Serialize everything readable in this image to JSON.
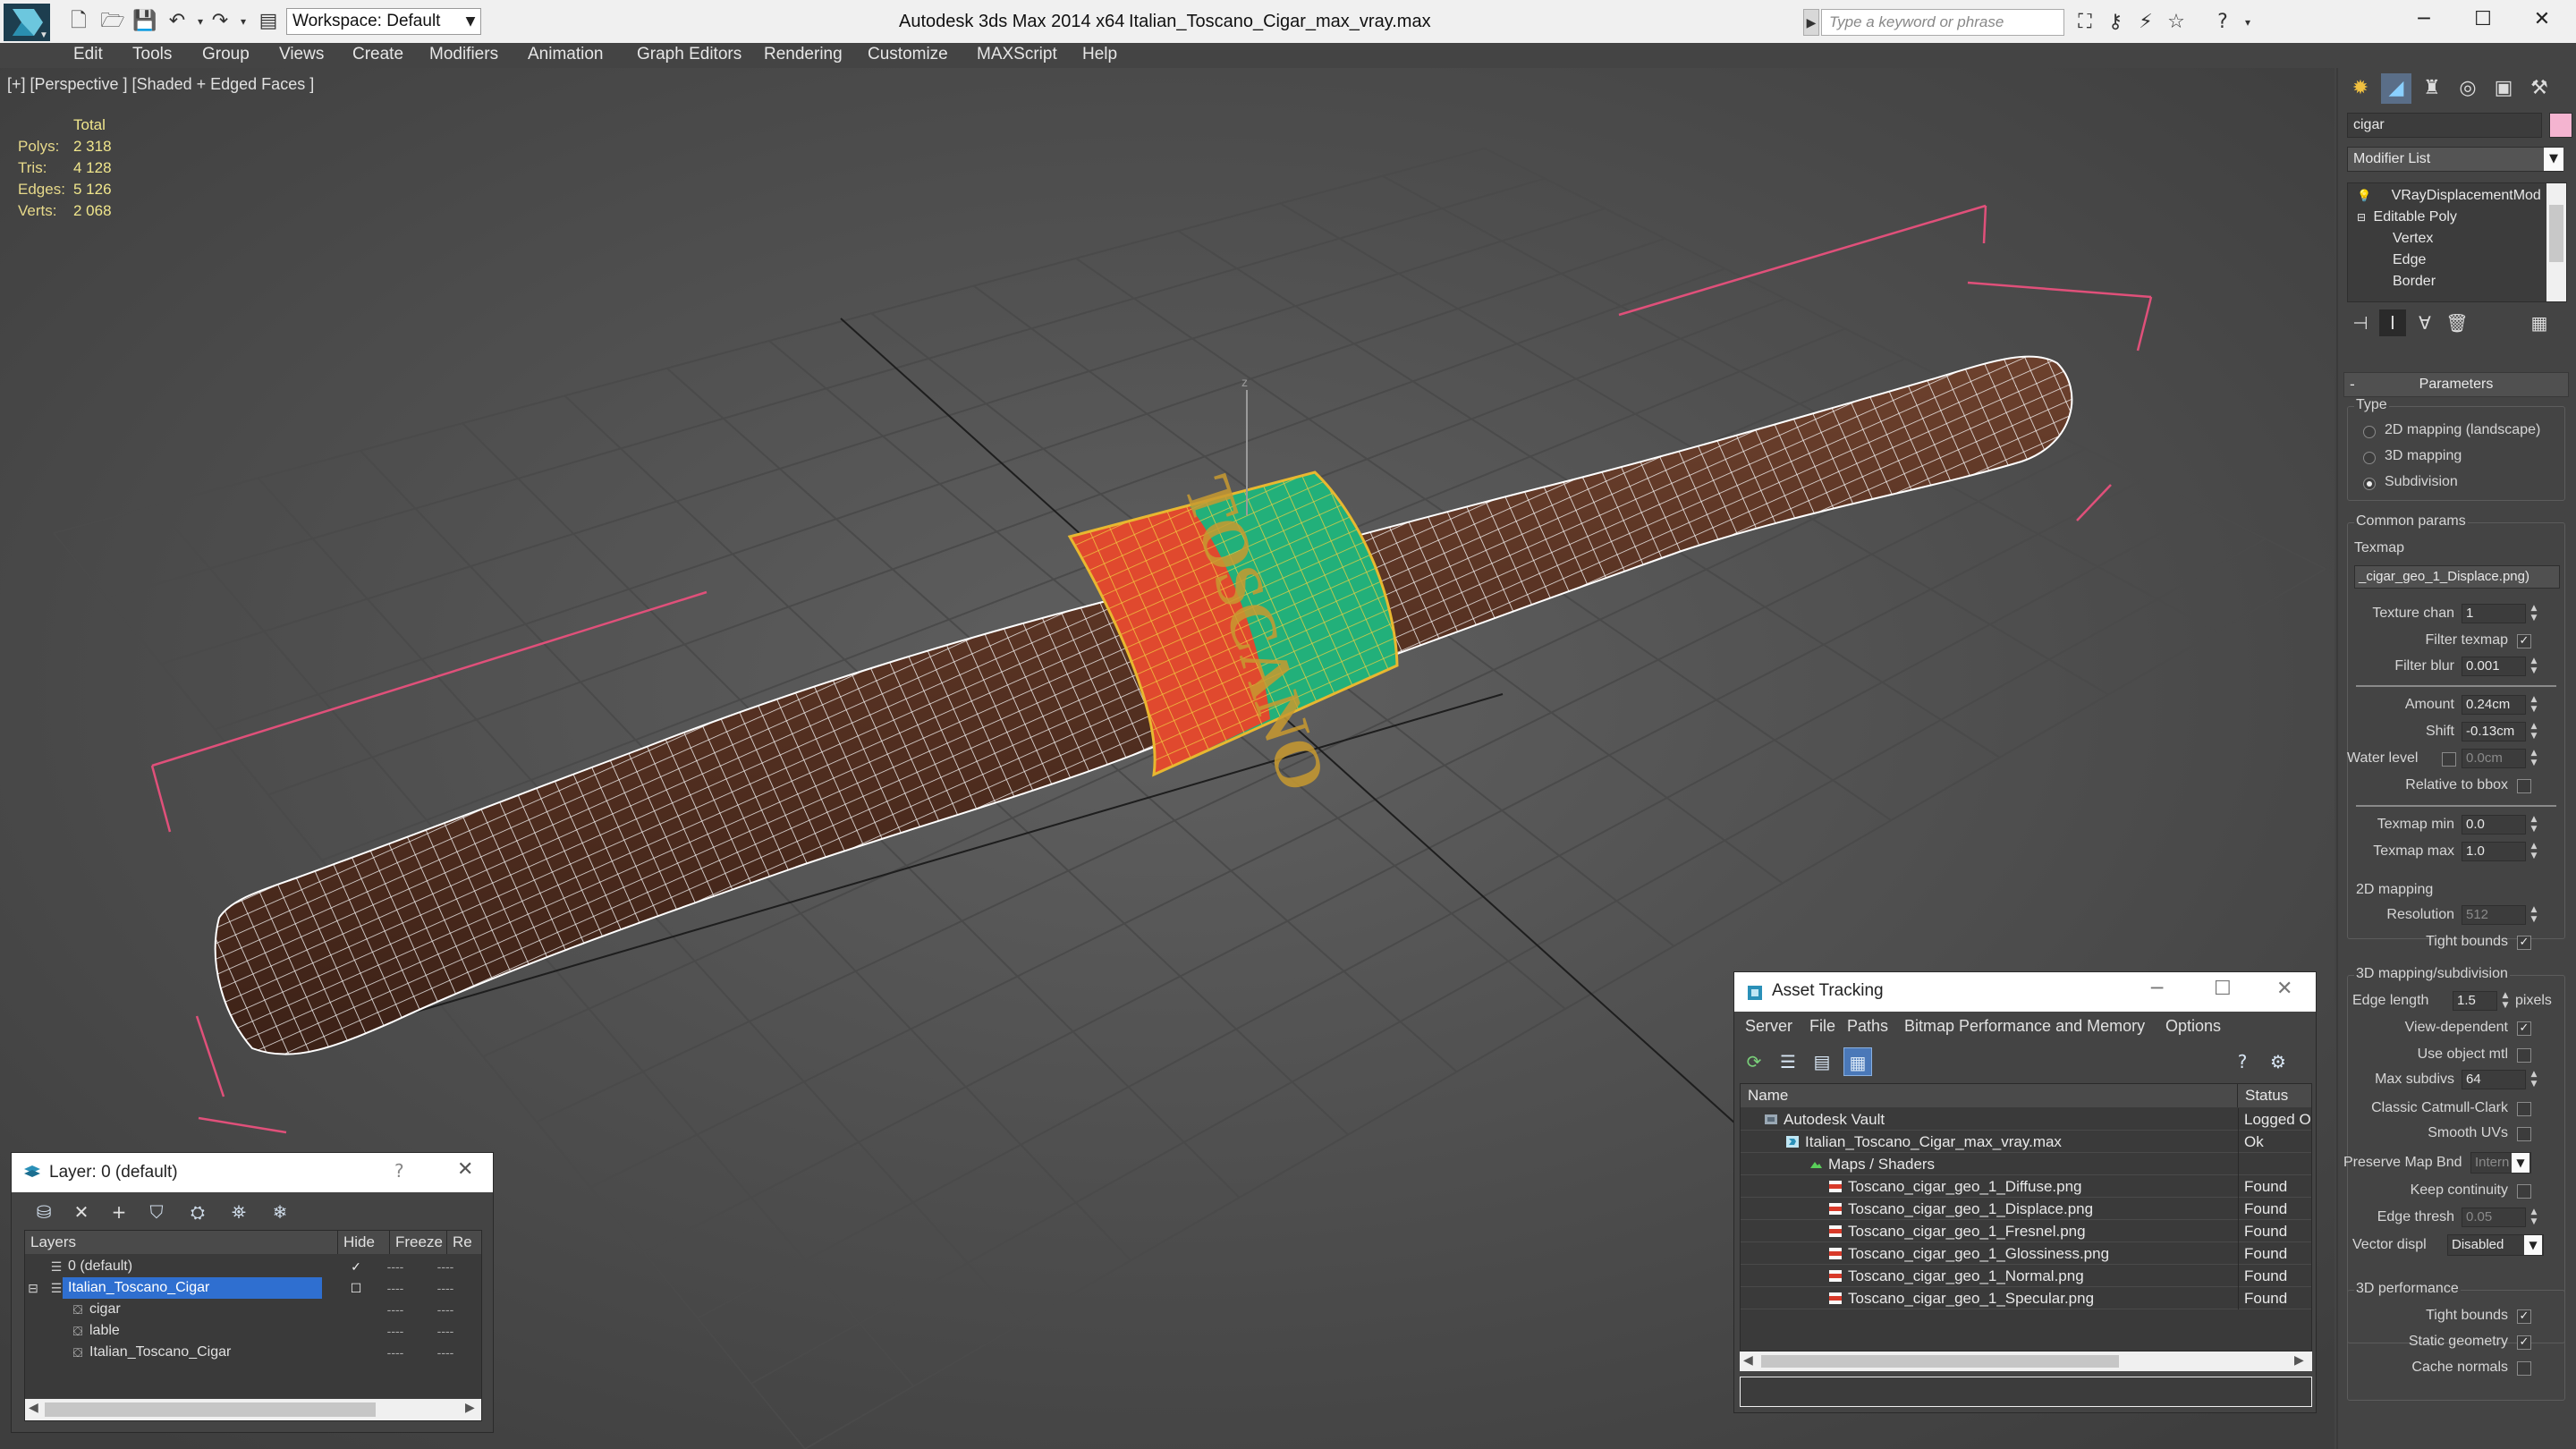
{
  "titlebar": {
    "app_title": "Autodesk 3ds Max 2014 x64",
    "document": "Italian_Toscano_Cigar_max_vray.max",
    "workspace": "Workspace: Default",
    "search_placeholder": "Type a keyword or phrase"
  },
  "menu": [
    "Edit",
    "Tools",
    "Group",
    "Views",
    "Create",
    "Modifiers",
    "Animation",
    "Graph Editors",
    "Rendering",
    "Customize",
    "MAXScript",
    "Help"
  ],
  "viewport": {
    "label": "[+] [Perspective ] [Shaded + Edged Faces ]",
    "stats": {
      "header": "Total",
      "rows": [
        {
          "label": "Polys:",
          "value": "2 318"
        },
        {
          "label": "Tris:",
          "value": "4 128"
        },
        {
          "label": "Edges:",
          "value": "5 126"
        },
        {
          "label": "Verts:",
          "value": "2 068"
        }
      ]
    },
    "band_text": "TOSCANO"
  },
  "command_panel": {
    "object_name": "cigar",
    "object_color": "#f4b4d0",
    "modifier_list": "Modifier List",
    "stack": [
      {
        "label": "VRayDisplacementMod",
        "level": 0
      },
      {
        "label": "Editable Poly",
        "level": 0
      },
      {
        "label": "Vertex",
        "level": 1
      },
      {
        "label": "Edge",
        "level": 1
      },
      {
        "label": "Border",
        "level": 1
      }
    ],
    "rollout_title": "Parameters",
    "type_group": "Type",
    "type_options": [
      {
        "label": "2D mapping (landscape)",
        "selected": false
      },
      {
        "label": "3D mapping",
        "selected": false
      },
      {
        "label": "Subdivision",
        "selected": true
      }
    ],
    "common_group": "Common params",
    "texmap_label": "Texmap",
    "texmap_value": "_cigar_geo_1_Displace.png)",
    "texture_chan_label": "Texture chan",
    "texture_chan": "1",
    "filter_texmap_label": "Filter texmap",
    "filter_blur_label": "Filter blur",
    "filter_blur": "0.001",
    "amount_label": "Amount",
    "amount": "0.24cm",
    "shift_label": "Shift",
    "shift": "-0.13cm",
    "water_level_label": "Water level",
    "water_level": "0.0cm",
    "relative_bbox_label": "Relative to bbox",
    "texmap_min_label": "Texmap min",
    "texmap_min": "0.0",
    "texmap_max_label": "Texmap max",
    "texmap_max": "1.0",
    "mapping2d_group": "2D mapping",
    "resolution_label": "Resolution",
    "resolution": "512",
    "tight_bounds_label": "Tight bounds",
    "mapping3d_group": "3D mapping/subdivision",
    "edge_length_label": "Edge length",
    "edge_length": "1.5",
    "edge_length_unit": "pixels",
    "view_dependent_label": "View-dependent",
    "use_object_mtl_label": "Use object mtl",
    "max_subdivs_label": "Max subdivs",
    "max_subdivs": "64",
    "classic_catmull_label": "Classic Catmull-Clark",
    "smooth_uvs_label": "Smooth UVs",
    "preserve_map_label": "Preserve Map Bnd",
    "preserve_map": "Intern",
    "keep_continuity_label": "Keep continuity",
    "edge_thresh_label": "Edge thresh",
    "edge_thresh": "0.05",
    "vector_displ_label": "Vector displ",
    "vector_displ": "Disabled",
    "perf_group": "3D performance",
    "perf_tight_bounds_label": "Tight bounds",
    "static_geometry_label": "Static geometry",
    "cache_normals_label": "Cache normals"
  },
  "layer_dialog": {
    "title": "Layer: 0 (default)",
    "help": "?",
    "columns": [
      "Layers",
      "Hide",
      "Freeze",
      "Re"
    ],
    "rows": [
      {
        "name": "0 (default)",
        "hide": "----",
        "freeze": "----",
        "level": 0,
        "selected": false,
        "active": true
      },
      {
        "name": "Italian_Toscano_Cigar",
        "hide": "----",
        "freeze": "----",
        "level": 0,
        "selected": true,
        "active": false
      },
      {
        "name": "cigar",
        "hide": "----",
        "freeze": "----",
        "level": 1,
        "selected": false,
        "active": false
      },
      {
        "name": "lable",
        "hide": "----",
        "freeze": "----",
        "level": 1,
        "selected": false,
        "active": false
      },
      {
        "name": "Italian_Toscano_Cigar",
        "hide": "----",
        "freeze": "----",
        "level": 1,
        "selected": false,
        "active": false
      }
    ]
  },
  "asset_dialog": {
    "title": "Asset Tracking",
    "menu": [
      "Server",
      "File",
      "Paths",
      "Bitmap Performance and Memory",
      "Options"
    ],
    "columns": [
      "Name",
      "Status"
    ],
    "rows": [
      {
        "name": "Autodesk Vault",
        "status": "Logged Out",
        "indent": 0,
        "icon": "vault-icon"
      },
      {
        "name": "Italian_Toscano_Cigar_max_vray.max",
        "status": "Ok",
        "indent": 1,
        "icon": "max-file-icon"
      },
      {
        "name": "Maps / Shaders",
        "status": "",
        "indent": 2,
        "icon": "maps-icon"
      },
      {
        "name": "Toscano_cigar_geo_1_Diffuse.png",
        "status": "Found",
        "indent": 3,
        "icon": "png-icon"
      },
      {
        "name": "Toscano_cigar_geo_1_Displace.png",
        "status": "Found",
        "indent": 3,
        "icon": "png-icon"
      },
      {
        "name": "Toscano_cigar_geo_1_Fresnel.png",
        "status": "Found",
        "indent": 3,
        "icon": "png-icon"
      },
      {
        "name": "Toscano_cigar_geo_1_Glossiness.png",
        "status": "Found",
        "indent": 3,
        "icon": "png-icon"
      },
      {
        "name": "Toscano_cigar_geo_1_Normal.png",
        "status": "Found",
        "indent": 3,
        "icon": "png-icon"
      },
      {
        "name": "Toscano_cigar_geo_1_Specular.png",
        "status": "Found",
        "indent": 3,
        "icon": "png-icon"
      }
    ]
  },
  "colors": {
    "viewport_bg": "#5a5a5a",
    "stats_text": "#f0e68c",
    "selection_blue": "#2f6fd0",
    "band_red": "#e0492e",
    "band_green": "#22b07a",
    "cigar_brown": "#5a3424",
    "bbox_pink": "#e0507a"
  }
}
